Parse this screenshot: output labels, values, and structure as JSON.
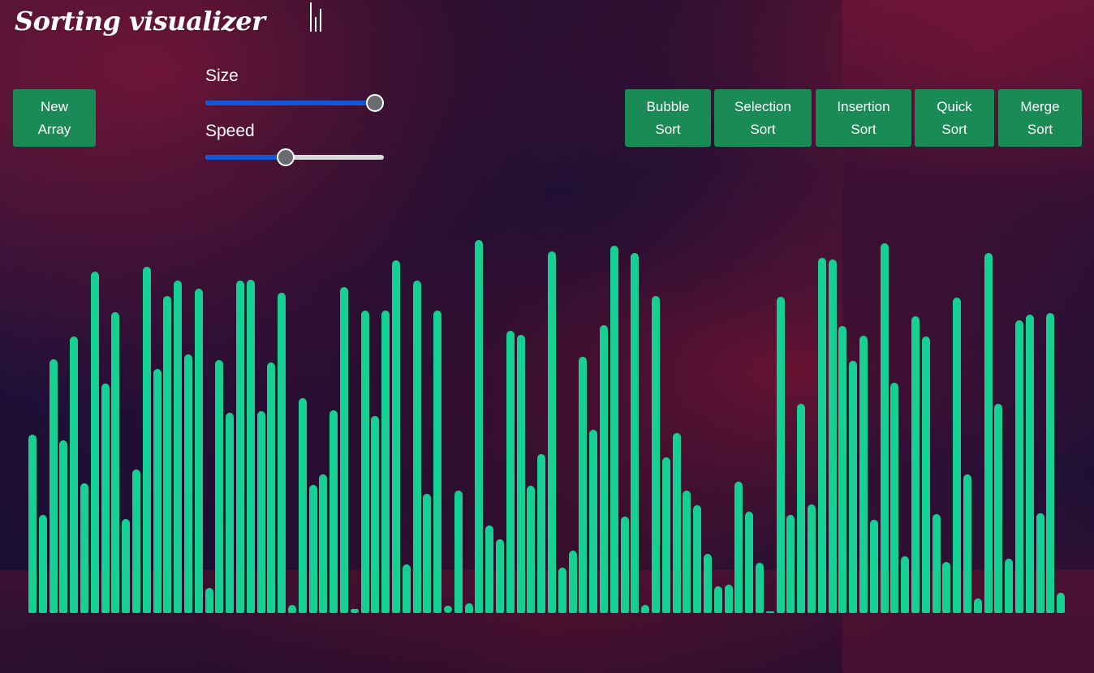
{
  "app": {
    "title": "Sorting visualizer",
    "logo_icon": "bar-chart-icon"
  },
  "controls": {
    "new_array_label": "New Array",
    "size_label": "Size",
    "speed_label": "Speed",
    "size_fraction": 0.95,
    "speed_fraction": 0.45
  },
  "algorithms": [
    {
      "key": "bubble",
      "label": "Bubble Sort"
    },
    {
      "key": "selection",
      "label": "Selection Sort"
    },
    {
      "key": "insertion",
      "label": "Insertion Sort"
    },
    {
      "key": "quick",
      "label": "Quick Sort"
    },
    {
      "key": "merge",
      "label": "Merge Sort"
    }
  ],
  "colors": {
    "button": "#1a8a57",
    "bar": "#16cf92",
    "slider_fill": "#1456d6"
  },
  "array": {
    "values": [
      220,
      121,
      313,
      213,
      341,
      160,
      421,
      283,
      371,
      116,
      177,
      427,
      301,
      391,
      410,
      319,
      400,
      31,
      312,
      247,
      410,
      411,
      249,
      309,
      395,
      10,
      265,
      158,
      171,
      250,
      402,
      5,
      373,
      243,
      373,
      435,
      60,
      410,
      147,
      373,
      9,
      151,
      12,
      460,
      108,
      91,
      348,
      343,
      157,
      196,
      446,
      56,
      77,
      316,
      226,
      355,
      453,
      119,
      444,
      10,
      391,
      192,
      222,
      151,
      133,
      73,
      33,
      35,
      162,
      125,
      62,
      1,
      390,
      121,
      258,
      134,
      438,
      436,
      354,
      311,
      342,
      115,
      456,
      284,
      70,
      366,
      341,
      122,
      63,
      389,
      171,
      18,
      444,
      258,
      67,
      361,
      368,
      123,
      370,
      25
    ]
  }
}
